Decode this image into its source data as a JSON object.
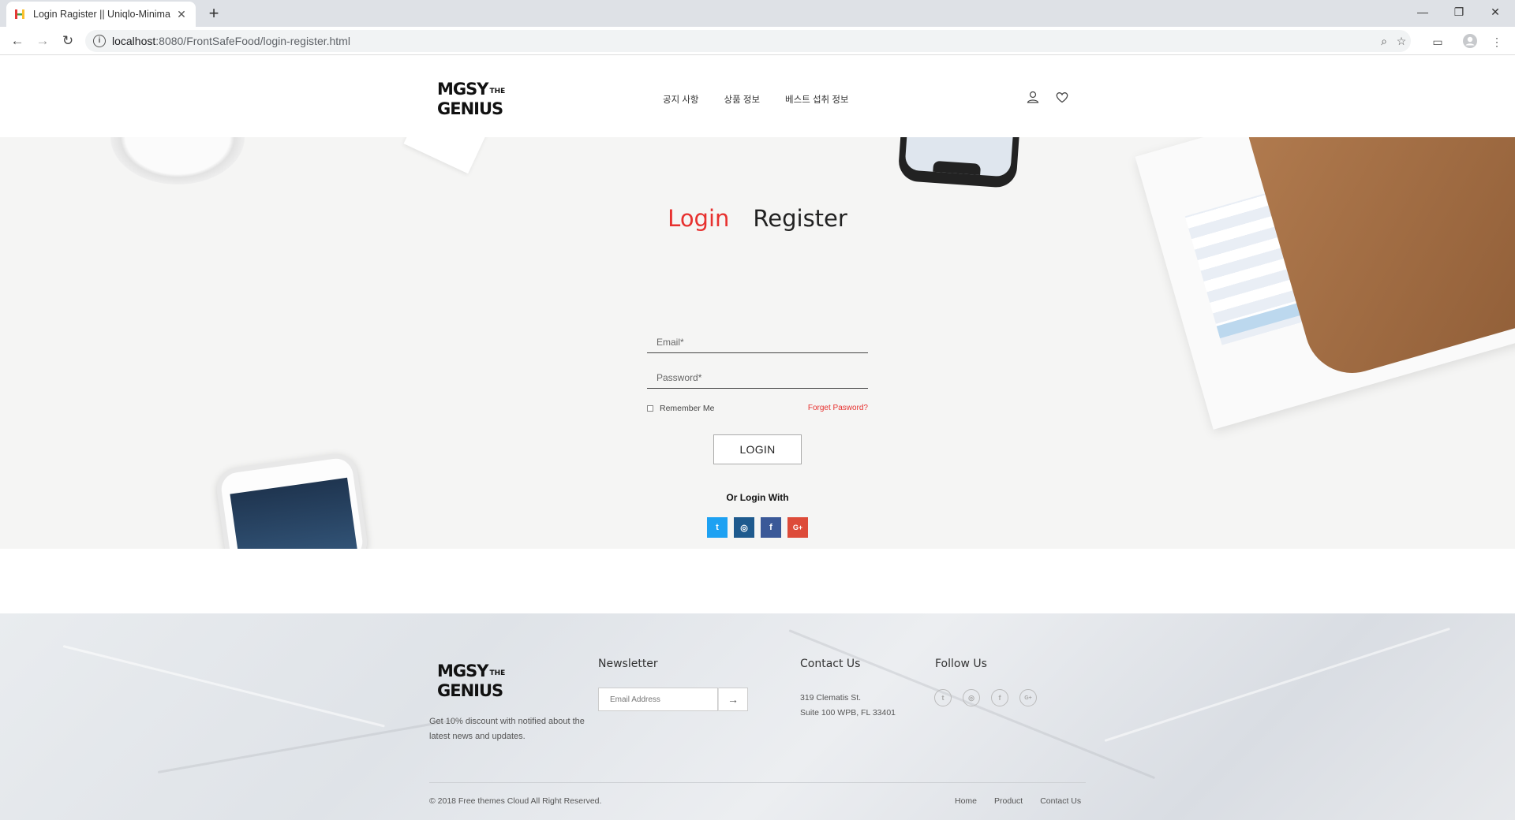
{
  "browser": {
    "tab_title": "Login Ragister || Uniqlo-Minima",
    "tab_close": "✕",
    "new_tab": "+",
    "url_host": "localhost",
    "url_path": ":8080/FrontSafeFood/login-register.html"
  },
  "header": {
    "logo_line1": "MGSY",
    "logo_the": "THE",
    "logo_line2": "GENIUS",
    "nav": [
      "공지 사항",
      "상품 정보",
      "베스트 섭취 정보"
    ]
  },
  "login": {
    "tab_login": "Login",
    "tab_register": "Register",
    "email_placeholder": "Email*",
    "password_placeholder": "Password*",
    "remember_label": "Remember Me",
    "forgot_label": "Forget Pasword?",
    "login_button": "LOGIN",
    "or_login_with": "Or Login With",
    "socials": [
      {
        "name": "twitter",
        "glyph": "t",
        "color": "#1da1f2"
      },
      {
        "name": "instagram",
        "glyph": "◎",
        "color": "#1e5a8e"
      },
      {
        "name": "facebook",
        "glyph": "f",
        "color": "#3b5998"
      },
      {
        "name": "google-plus",
        "glyph": "G+",
        "color": "#dd4b39"
      }
    ]
  },
  "footer": {
    "description": "Get 10% discount with notified about the latest news and updates.",
    "newsletter_title": "Newsletter",
    "newsletter_placeholder": "Email Address",
    "newsletter_button": "→",
    "contact_title": "Contact Us",
    "address_line1": "319 Clematis St.",
    "address_line2": "Suite 100 WPB, FL 33401",
    "follow_title": "Follow Us",
    "copyright": "© 2018 Free themes Cloud All Right Reserved.",
    "links": [
      "Home",
      "Product",
      "Contact Us"
    ]
  }
}
